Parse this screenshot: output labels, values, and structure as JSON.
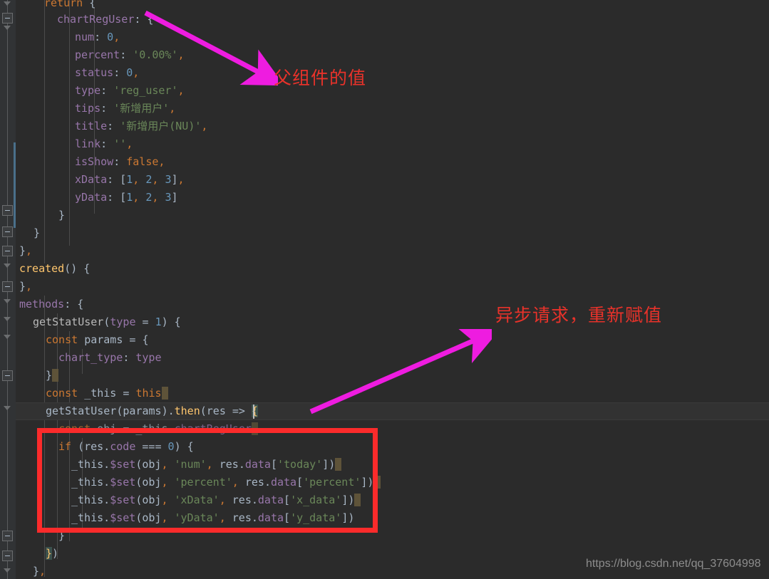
{
  "editor": {
    "theme_background": "#2b2b2b",
    "gutter_background": "#313335",
    "current_line_background": "#323232",
    "default_text_color": "#a9b7c6",
    "code_lines": [
      {
        "indent": 2,
        "text": "return {"
      },
      {
        "indent": 3,
        "text": "chartRegUser: {"
      },
      {
        "indent": 4,
        "text": "num: 0,"
      },
      {
        "indent": 4,
        "text": "percent: '0.00%',"
      },
      {
        "indent": 4,
        "text": "status: 0,"
      },
      {
        "indent": 4,
        "text": "type: 'reg_user',"
      },
      {
        "indent": 4,
        "text": "tips: '新增用户',"
      },
      {
        "indent": 4,
        "text": "title: '新增用户(NU)',"
      },
      {
        "indent": 4,
        "text": "link: '',"
      },
      {
        "indent": 4,
        "text": "isShow: false,"
      },
      {
        "indent": 4,
        "text": "xData: [1, 2, 3],"
      },
      {
        "indent": 4,
        "text": "yData: [1, 2, 3]"
      },
      {
        "indent": 3,
        "text": "}"
      },
      {
        "indent": 2,
        "text": "}"
      },
      {
        "indent": 1,
        "text": "},"
      },
      {
        "indent": 1,
        "text": "created() {"
      },
      {
        "indent": 1,
        "text": "},"
      },
      {
        "indent": 1,
        "text": "methods: {"
      },
      {
        "indent": 2,
        "text": "getStatUser(type = 1) {"
      },
      {
        "indent": 3,
        "text": "const params = {"
      },
      {
        "indent": 4,
        "text": "chart_type: type"
      },
      {
        "indent": 3,
        "text": "}"
      },
      {
        "indent": 3,
        "text": "const _this = this"
      },
      {
        "indent": 3,
        "text": "getStatUser(params).then(res => {"
      },
      {
        "indent": 4,
        "text": "const obj = _this.chartRegUser"
      },
      {
        "indent": 4,
        "text": "if (res.code === 0) {"
      },
      {
        "indent": 5,
        "text": "_this.$set(obj, 'num', res.data['today'])"
      },
      {
        "indent": 5,
        "text": "_this.$set(obj, 'percent', res.data['percent'])"
      },
      {
        "indent": 5,
        "text": "_this.$set(obj, 'xData', res.data['x_data'])"
      },
      {
        "indent": 5,
        "text": "_this.$set(obj, 'yData', res.data['y_data'])"
      },
      {
        "indent": 4,
        "text": "}"
      },
      {
        "indent": 3,
        "text": "})"
      },
      {
        "indent": 2,
        "text": "},"
      }
    ],
    "current_line_text": "getStatUser(params).then(res => {",
    "gutter_icons": [
      "fold-collapse-icon",
      "fold-collapse-icon",
      "fold-collapse-icon",
      "fold-collapse-icon",
      "fold-collapse-icon",
      "fold-collapse-icon",
      "fold-collapse-icon",
      "fold-collapse-icon",
      "fold-collapse-icon"
    ]
  },
  "annotations": {
    "arrow_color": "#ee1ce0",
    "text_color": "#e8322a",
    "box_color": "#fb2b2b",
    "note_1": "父组件的值",
    "note_2": "异步请求，重新赋值",
    "highlight_box_label": "reassignment-highlight-box"
  },
  "watermark": {
    "text": "https://blog.csdn.net/qq_37604998",
    "color": "#8d8d8d"
  }
}
